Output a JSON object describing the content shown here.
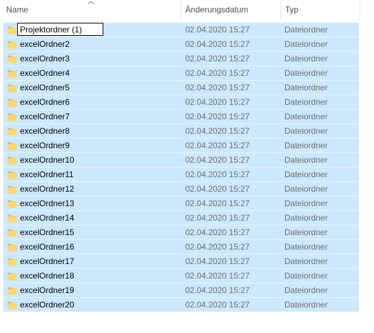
{
  "columns": {
    "name": "Name",
    "date": "Änderungsdatum",
    "type": "Typ"
  },
  "sort": {
    "column": "name",
    "icon": "sort-ascending-chevron-icon"
  },
  "rename": {
    "value": "Projektordner (1)"
  },
  "rows": [
    {
      "name": "Projektordner (1)",
      "date": "02.04.2020 15:27",
      "type": "Dateiordner",
      "renaming": true
    },
    {
      "name": "excelOrdner2",
      "date": "02.04.2020 15:27",
      "type": "Dateiordner"
    },
    {
      "name": "excelOrdner3",
      "date": "02.04.2020 15:27",
      "type": "Dateiordner"
    },
    {
      "name": "excelOrdner4",
      "date": "02.04.2020 15:27",
      "type": "Dateiordner"
    },
    {
      "name": "excelOrdner5",
      "date": "02.04.2020 15:27",
      "type": "Dateiordner"
    },
    {
      "name": "excelOrdner6",
      "date": "02.04.2020 15:27",
      "type": "Dateiordner"
    },
    {
      "name": "excelOrdner7",
      "date": "02.04.2020 15:27",
      "type": "Dateiordner"
    },
    {
      "name": "excelOrdner8",
      "date": "02.04.2020 15:27",
      "type": "Dateiordner"
    },
    {
      "name": "excelOrdner9",
      "date": "02.04.2020 15:27",
      "type": "Dateiordner"
    },
    {
      "name": "excelOrdner10",
      "date": "02.04.2020 15:27",
      "type": "Dateiordner"
    },
    {
      "name": "excelOrdner11",
      "date": "02.04.2020 15:27",
      "type": "Dateiordner"
    },
    {
      "name": "excelOrdner12",
      "date": "02.04.2020 15:27",
      "type": "Dateiordner"
    },
    {
      "name": "excelOrdner13",
      "date": "02.04.2020 15:27",
      "type": "Dateiordner"
    },
    {
      "name": "excelOrdner14",
      "date": "02.04.2020 15:27",
      "type": "Dateiordner"
    },
    {
      "name": "excelOrdner15",
      "date": "02.04.2020 15:27",
      "type": "Dateiordner"
    },
    {
      "name": "excelOrdner16",
      "date": "02.04.2020 15:27",
      "type": "Dateiordner"
    },
    {
      "name": "excelOrdner17",
      "date": "02.04.2020 15:27",
      "type": "Dateiordner"
    },
    {
      "name": "excelOrdner18",
      "date": "02.04.2020 15:27",
      "type": "Dateiordner"
    },
    {
      "name": "excelOrdner19",
      "date": "02.04.2020 15:27",
      "type": "Dateiordner"
    },
    {
      "name": "excelOrdner20",
      "date": "02.04.2020 15:27",
      "type": "Dateiordner"
    }
  ],
  "colors": {
    "selection": "#cce8ff",
    "folder": "#f8d775",
    "folder_dark": "#e8b640",
    "header_text": "#4d4d4d",
    "secondary_text": "#6d6d6d"
  },
  "icons": {
    "row": "folder-icon"
  }
}
